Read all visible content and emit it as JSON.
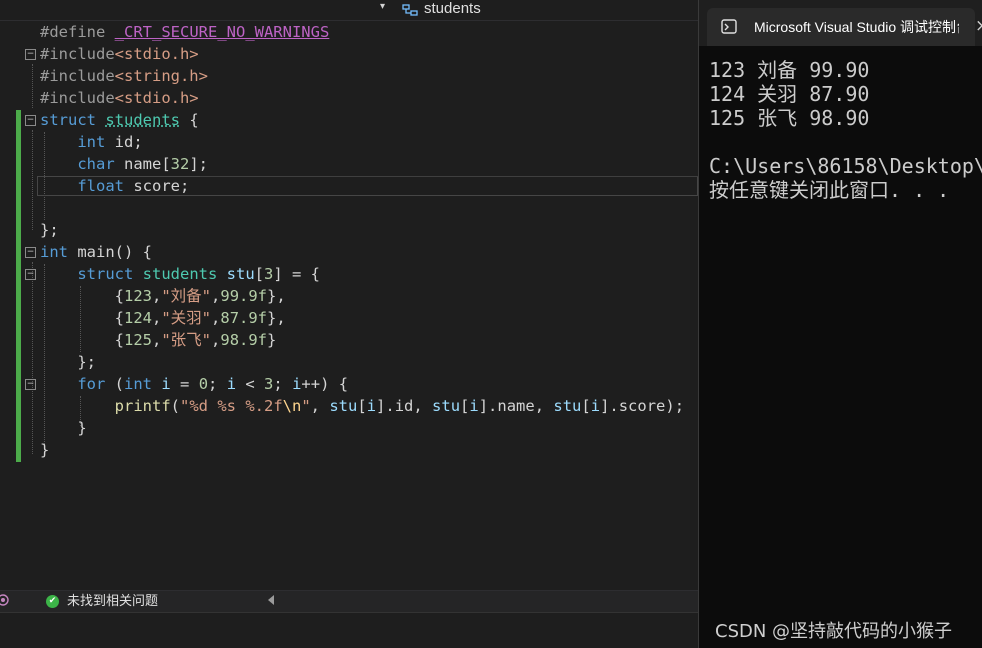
{
  "editor": {
    "nav": {
      "dropdown_arrow": "▾",
      "class_label": "students",
      "class_icon": "struct-icon"
    },
    "code": {
      "l1": {
        "pp": "#define",
        "sp": " ",
        "macro": "_CRT_SECURE_NO_WARNINGS"
      },
      "l2": {
        "pp": "#include",
        "file": "<stdio.h>"
      },
      "l3": {
        "pp": "#include",
        "file": "<string.h>"
      },
      "l4": {
        "pp": "#include",
        "file": "<stdio.h>"
      },
      "l5": {
        "kw": "struct",
        "sp": " ",
        "name": "students",
        "rest": " {"
      },
      "l6": {
        "indent": "    ",
        "kw": "int",
        "rest": " id;"
      },
      "l7": {
        "indent": "    ",
        "kw": "char",
        "rest": " name[",
        "num": "32",
        "end": "];"
      },
      "l8": {
        "indent": "    ",
        "kw": "float",
        "rest": " score;"
      },
      "l9": {
        "text": "};"
      },
      "l10": {
        "kw": "int",
        "rest": " main() {"
      },
      "l11": {
        "indent": "    ",
        "kw": "struct",
        "sp": " ",
        "ty": "students",
        "sp2": " ",
        "var": "stu",
        "p1": "[",
        "num": "3",
        "p2": "] = {"
      },
      "l12": {
        "indent": "        ",
        "p1": "{",
        "num1": "123",
        "c1": ",",
        "str": "\"刘备\"",
        "c2": ",",
        "num2": "99.9f",
        "p2": "},"
      },
      "l13": {
        "indent": "        ",
        "p1": "{",
        "num1": "124",
        "c1": ",",
        "str": "\"关羽\"",
        "c2": ",",
        "num2": "87.9f",
        "p2": "},"
      },
      "l14": {
        "indent": "        ",
        "p1": "{",
        "num1": "125",
        "c1": ",",
        "str": "\"张飞\"",
        "c2": ",",
        "num2": "98.9f",
        "p2": "}"
      },
      "l15": {
        "indent": "    ",
        "text": "};"
      },
      "l16": {
        "indent": "    ",
        "kw": "for",
        "p1": " (",
        "kw2": "int",
        "sp": " ",
        "var": "i",
        "p2": " = ",
        "num": "0",
        "p3": "; ",
        "var2": "i",
        "p4": " < ",
        "num2": "3",
        "p5": "; ",
        "var3": "i",
        "p6": "++) {"
      },
      "l17": {
        "indent": "        ",
        "fn": "printf",
        "p1": "(",
        "s1": "\"%d %s %.2f",
        "esc": "\\n",
        "s2": "\"",
        "p2": ", ",
        "v1": "stu",
        "p3": "[",
        "v2": "i",
        "p4": "].id, ",
        "v3": "stu",
        "p5": "[",
        "v4": "i",
        "p6": "].name, ",
        "v5": "stu",
        "p7": "[",
        "v6": "i",
        "p8": "].score);"
      },
      "l18": {
        "indent": "    ",
        "text": "}"
      },
      "l19": {
        "text": "}"
      }
    },
    "fold_glyph": "−",
    "issues": {
      "icon": "check-circle-icon",
      "glyph": "✔",
      "text": "未找到相关问题"
    }
  },
  "console": {
    "title": "Microsoft Visual Studio 调试控制台",
    "close_glyph": "×",
    "lines": [
      "123 刘备 99.90",
      "124 关羽 87.90",
      "125 张飞 98.90",
      "",
      "C:\\Users\\86158\\Desktop\\",
      "按任意键关闭此窗口. . ."
    ]
  },
  "watermark": "CSDN @坚持敲代码的小猴子",
  "colors": {
    "keyword": "#569cd6",
    "type": "#4ec9b0",
    "string": "#d69d85",
    "number": "#b5cea8",
    "macro": "#bd63c5",
    "change_bar": "#4cab4a"
  }
}
